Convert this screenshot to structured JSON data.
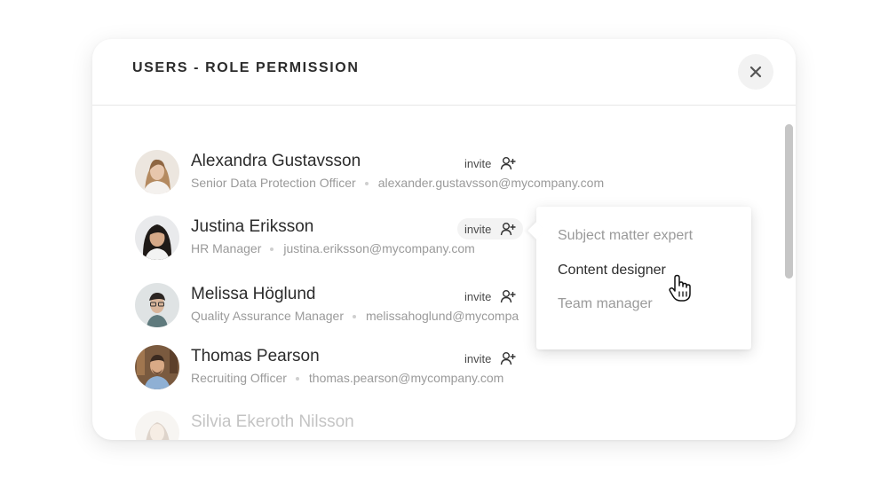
{
  "modal": {
    "title": "USERS - ROLE PERMISSION",
    "close_icon": "close-icon"
  },
  "users": [
    {
      "name": "Alexandra Gustavsson",
      "role": "Senior Data Protection Officer",
      "email": "alexander.gustavsson@mycompany.com",
      "invite_label": "invite"
    },
    {
      "name": "Justina Eriksson",
      "role": "HR Manager",
      "email": "justina.eriksson@mycompany.com",
      "invite_label": "invite"
    },
    {
      "name": "Melissa Höglund",
      "role": "Quality Assurance Manager",
      "email": "melissahoglund@mycompa",
      "invite_label": "invite"
    },
    {
      "name": "Thomas Pearson",
      "role": "Recruiting Officer",
      "email": "thomas.pearson@mycompany.com",
      "invite_label": "invite"
    },
    {
      "name": "Silvia Ekeroth Nilsson"
    }
  ],
  "role_dropdown": {
    "options": [
      "Subject matter expert",
      "Content designer",
      "Team manager"
    ],
    "selected": "Content designer"
  },
  "icons": {
    "invite": "add-user-icon",
    "cursor": "hand-pointer-icon"
  },
  "colors": {
    "title": "#2b2b2b",
    "name": "#2c2c2c",
    "muted": "#9a9a9a",
    "scrollbar": "#c6c6c6"
  }
}
